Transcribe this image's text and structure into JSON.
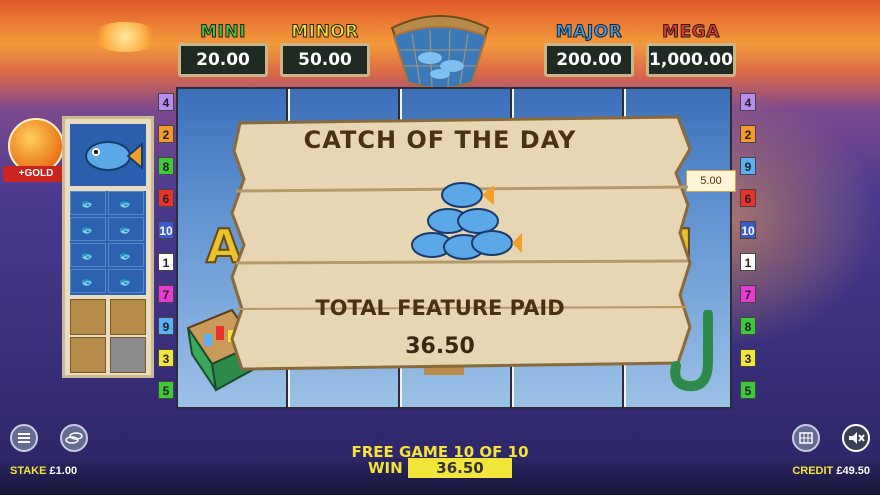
{
  "jackpots": [
    {
      "label": "MINI",
      "value": "20.00",
      "color": "#3ec83a"
    },
    {
      "label": "MINOR",
      "value": "50.00",
      "color": "#f3df2a"
    },
    {
      "label": "MAJOR",
      "value": "200.00",
      "color": "#3a9cf0"
    },
    {
      "label": "MEGA",
      "value": "1,000.00",
      "color": "#e8322a"
    }
  ],
  "paylines_left": [
    "4",
    "2",
    "8",
    "6",
    "10",
    "1",
    "7",
    "9",
    "3",
    "5"
  ],
  "paylines_right": [
    "4",
    "2",
    "9",
    "6",
    "10",
    "1",
    "7",
    "8",
    "3",
    "5"
  ],
  "payline_colors": {
    "1": "#ffffff",
    "2": "#f39a2a",
    "3": "#f3e53a",
    "4": "#b88cf0",
    "5": "#3ec83a",
    "6": "#e8322a",
    "7": "#e83ad0",
    "8": "#3ec83a",
    "9": "#5ab0f0",
    "10": "#3a5ad0"
  },
  "side_panel": {
    "gold_label": "+GOLD"
  },
  "feature": {
    "title": "CATCH OF THE DAY",
    "subtitle": "TOTAL FEATURE PAID",
    "amount": "36.50"
  },
  "tag_value": "5.00",
  "bottom": {
    "free_game": "FREE GAME 10 OF 10",
    "win_label": "WIN",
    "win_value": "36.50",
    "stake_label": "STAKE",
    "stake_value": "£1.00",
    "credit_label": "CREDIT",
    "credit_value": "£49.50"
  },
  "icons": {
    "menu": "menu-icon",
    "coins": "coins-icon",
    "paytable": "paytable-icon",
    "sound": "sound-muted-icon"
  }
}
